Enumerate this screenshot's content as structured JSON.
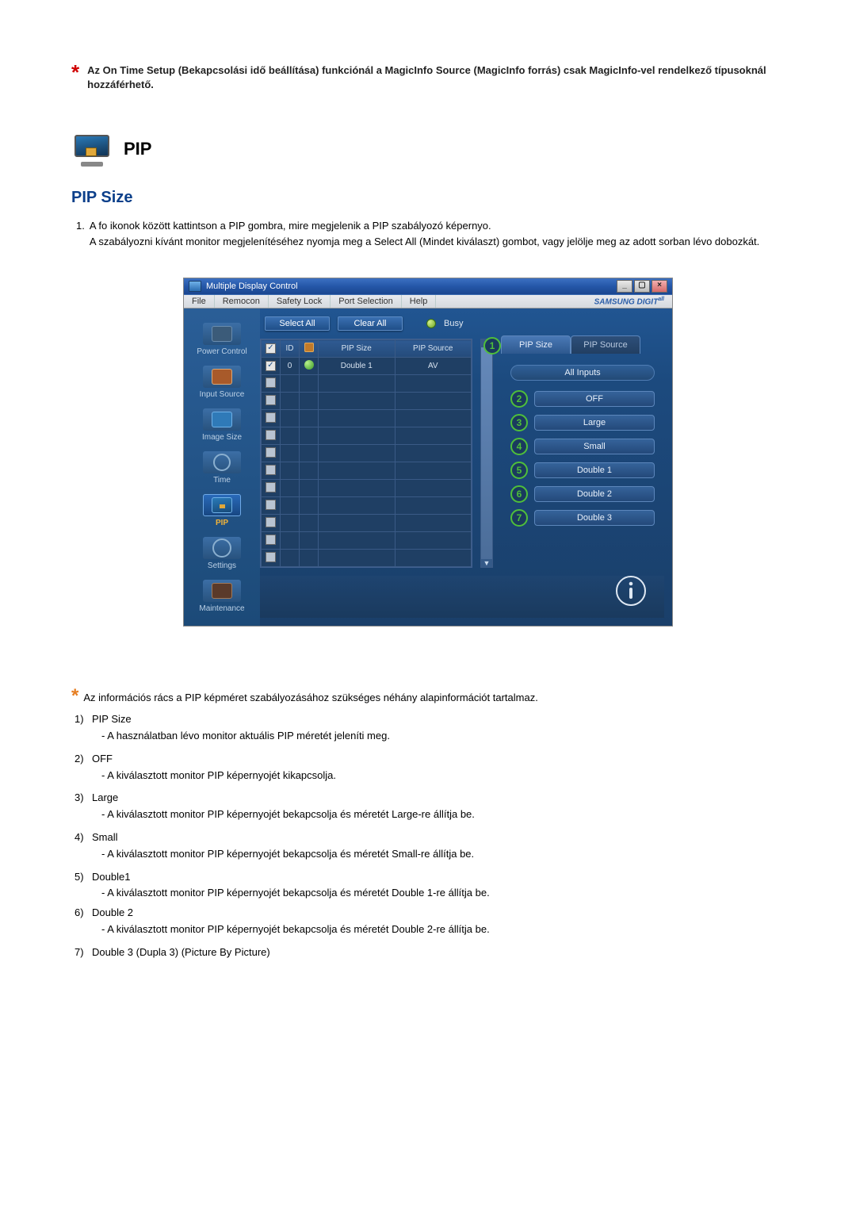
{
  "top_note": "Az On Time Setup (Bekapcsolási idő beállítása) funkciónál a MagicInfo Source (MagicInfo forrás) csak MagicInfo-vel rendelkező típusoknál hozzáférhető.",
  "pip_heading": "PIP",
  "sub_heading": "PIP Size",
  "instruction_number": "1.",
  "instruction_line1": "A fo ikonok között kattintson a PIP gombra, mire megjelenik a PIP szabályozó képernyo.",
  "instruction_line2": "A szabályozni kívánt monitor megjelenítéséhez nyomja meg a Select All (Mindet kiválaszt) gombot, vagy jelölje meg az adott sorban lévo dobozkát.",
  "window": {
    "title": "Multiple Display Control",
    "menu": [
      "File",
      "Remocon",
      "Safety Lock",
      "Port Selection",
      "Help"
    ],
    "brand": "SAMSUNG DIGITall",
    "sidebar": [
      {
        "label": "Power Control"
      },
      {
        "label": "Input Source"
      },
      {
        "label": "Image Size"
      },
      {
        "label": "Time"
      },
      {
        "label": "PIP"
      },
      {
        "label": "Settings"
      },
      {
        "label": "Maintenance"
      }
    ],
    "buttons": {
      "select_all": "Select All",
      "clear_all": "Clear All"
    },
    "busy_label": "Busy",
    "grid": {
      "headers": {
        "id": "ID",
        "pip_size": "PIP Size",
        "pip_source": "PIP Source"
      },
      "row1": {
        "id": "0",
        "pip_size": "Double 1",
        "pip_source": "AV"
      }
    },
    "right_panel": {
      "tab_active": "PIP Size",
      "tab_inactive": "PIP Source",
      "header_label": "All Inputs",
      "options": [
        {
          "num": "2",
          "label": "OFF"
        },
        {
          "num": "3",
          "label": "Large"
        },
        {
          "num": "4",
          "label": "Small"
        },
        {
          "num": "5",
          "label": "Double 1"
        },
        {
          "num": "6",
          "label": "Double 2"
        },
        {
          "num": "7",
          "label": "Double 3"
        }
      ],
      "tab_marker": "1"
    }
  },
  "legend_intro": "Az információs rács a PIP képméret szabályozásához szükséges néhány alapinformációt tartalmaz.",
  "legend": [
    {
      "num": "1)",
      "title": "PIP Size",
      "desc": "- A használatban lévo monitor aktuális PIP méretét jeleníti meg."
    },
    {
      "num": "2)",
      "title": "OFF",
      "desc": "- A kiválasztott monitor PIP képernyojét kikapcsolja."
    },
    {
      "num": "3)",
      "title": "Large",
      "desc": "- A kiválasztott monitor PIP képernyojét bekapcsolja és méretét Large-re állítja be."
    },
    {
      "num": "4)",
      "title": "Small",
      "desc": "- A kiválasztott monitor PIP képernyojét bekapcsolja és méretét Small-re állítja be."
    },
    {
      "num": "5)",
      "title": "Double1",
      "desc": "- A kiválasztott monitor PIP képernyojét bekapcsolja és méretét Double 1-re állítja be."
    },
    {
      "num": "6)",
      "title": "Double 2",
      "desc": "- A kiválasztott monitor PIP képernyojét bekapcsolja és méretét Double 2-re állítja be."
    },
    {
      "num": "7)",
      "title": "Double 3 (Dupla 3) (Picture By Picture)",
      "desc": ""
    }
  ]
}
